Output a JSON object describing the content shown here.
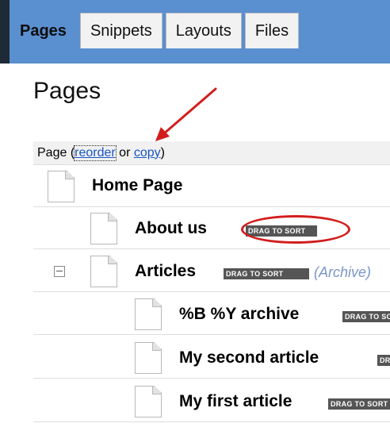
{
  "tabs": [
    {
      "label": "Pages",
      "active": true
    },
    {
      "label": "Snippets",
      "active": false
    },
    {
      "label": "Layouts",
      "active": false
    },
    {
      "label": "Files",
      "active": false
    }
  ],
  "page_title": "Pages",
  "header": {
    "prefix": "Page (",
    "reorder_link": "reorder",
    "middle": " or ",
    "copy_link": "copy",
    "suffix": ")"
  },
  "drag_badge": "DRAG TO SORT",
  "rows": [
    {
      "label": "Home Page",
      "level": 0,
      "badge": false,
      "collapse": false,
      "extra": ""
    },
    {
      "label": "About us",
      "level": 1,
      "badge": true,
      "collapse": false,
      "extra": ""
    },
    {
      "label": "Articles",
      "level": 1,
      "badge": true,
      "collapse": true,
      "extra": "(Archive)"
    },
    {
      "label": "%B %Y archive",
      "level": 2,
      "badge": true,
      "collapse": false,
      "extra": ""
    },
    {
      "label": "My second article",
      "level": 2,
      "badge": true,
      "collapse": false,
      "extra": ""
    },
    {
      "label": "My first article",
      "level": 2,
      "badge": true,
      "collapse": false,
      "extra": ""
    }
  ],
  "annotation_color": "#d21d1d",
  "accent_color": "#5a8fd0"
}
